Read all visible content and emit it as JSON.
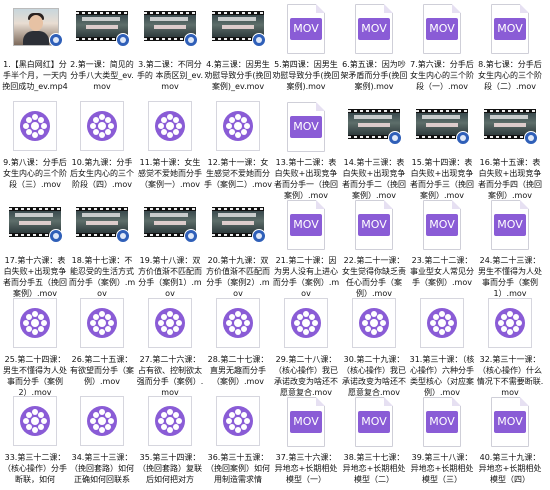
{
  "files": [
    {
      "name": "1.【黑白网红】分手半个月，一天内挽回成功_ev.mp4",
      "icon": "photo-thumbnail"
    },
    {
      "name": "2.第一课：简见的分手八大类型_ev.mov",
      "icon": "video-thumbnail"
    },
    {
      "name": "3.第二课：不同分手的 本质区别_ev.mov",
      "icon": "video-thumbnail"
    },
    {
      "name": "4.第三课：因男生劝慰导致分手(挽回案例)_ev.mov",
      "icon": "video-thumbnail"
    },
    {
      "name": "5.第四课：因男生劝慰导致分手(挽回案例).mov",
      "icon": "mov-icon"
    },
    {
      "name": "6.第五课：因为吵架矛盾而分手(挽回案例).mov",
      "icon": "mov-icon"
    },
    {
      "name": "7.第六课：分手后女生内心的三个阶段（一）.mov",
      "icon": "mov-icon"
    },
    {
      "name": "8.第七课：分手后女生内心的三个阶段（二）.mov",
      "icon": "mov-icon"
    },
    {
      "name": "9.第八课：分手后女生内心的三个阶段（三）.mov",
      "icon": "reel-icon"
    },
    {
      "name": "10.第九课：分手后女生内心的三个阶段（四）.mov",
      "icon": "reel-icon"
    },
    {
      "name": "11.第十课：女生感觉不爱她而分手（案例一）.mov",
      "icon": "reel-icon"
    },
    {
      "name": "12.第十一课：女生感觉不爱她而分手（案例二）.mov",
      "icon": "reel-icon"
    },
    {
      "name": "13.第十二课：表白失败+出现竞争者而分手一（挽回案例）.mov",
      "icon": "mov-icon"
    },
    {
      "name": "14.第十三课：表白失败+出现竞争者而分手二（挽回案例）.mov",
      "icon": "video-thumbnail"
    },
    {
      "name": "15.第十四课：表白失败+出现竞争者而分手三（挽回案例）.mov",
      "icon": "video-thumbnail"
    },
    {
      "name": "16.第十五课：表白失败+出现竞争者而分手四（挽回案例）.mov",
      "icon": "video-thumbnail"
    },
    {
      "name": "17.第十六课：表白失败+出现竞争者而分手五（挽回案例）.mov",
      "icon": "video-thumbnail"
    },
    {
      "name": "18.第十七课：不能忍受的生活方式而分手（案例）.mov",
      "icon": "video-thumbnail"
    },
    {
      "name": "19.第十八课：双方价值渐不匹配而分手（案例1）.mov",
      "icon": "video-thumbnail"
    },
    {
      "name": "20.第十九课：双方价值渐不匹配而分手（案例2）.mov",
      "icon": "video-thumbnail"
    },
    {
      "name": "21.第二十课：因为男人没有上进心而分手（案例）.mov",
      "icon": "mov-icon"
    },
    {
      "name": "22.第二十一课：女生觉得你缺乏责任心而分手（案例）.mov",
      "icon": "mov-icon"
    },
    {
      "name": "23.第二十二课：事业型女人常见分手（案例）.mov",
      "icon": "mov-icon"
    },
    {
      "name": "24.第二十三课：男生不懂得为人处事而分手（案例1）.mov",
      "icon": "mov-icon"
    },
    {
      "name": "25.第二十四课：男生不懂得为人处事而分手（案例2）.mov",
      "icon": "reel-icon"
    },
    {
      "name": "26.第二十五课：有欲望而分手（案例）.mov",
      "icon": "reel-icon"
    },
    {
      "name": "27.第二十六课：占有欲、控制欲太强而分手（案例）.mov",
      "icon": "reel-icon"
    },
    {
      "name": "28.第二十七课：直男无趣而分手（案例）.mov",
      "icon": "reel-icon"
    },
    {
      "name": "29.第二十八课：（核心操作）我已承诺改变为啥还不愿意复合.mov",
      "icon": "reel-icon"
    },
    {
      "name": "30.第二十九课：（核心操作）我已承诺改变为啥还不愿意复合.mov",
      "icon": "reel-icon"
    },
    {
      "name": "31.第三十课：（核心操作）六种分手类型核心（对应案例）.mov",
      "icon": "reel-icon"
    },
    {
      "name": "32.第三十一课：（核心操作）什么情况下不需要断联.mov",
      "icon": "reel-icon"
    },
    {
      "name": "33.第三十二课：（核心操作）分手断联，如何",
      "icon": "reel-icon"
    },
    {
      "name": "34.第三十三课：（挽回套路）如何正确如何回联系",
      "icon": "reel-icon"
    },
    {
      "name": "35.第三十四课：（挽回套路）复联后如何把对方",
      "icon": "reel-icon"
    },
    {
      "name": "36.第三十五课：（挽回案例）如何用制造需求情",
      "icon": "reel-icon"
    },
    {
      "name": "37.第三十六课：异地恋+长期相处模型（一）",
      "icon": "mov-icon"
    },
    {
      "name": "38.第三十七课：异地恋+长期相处模型（二）",
      "icon": "mov-icon"
    },
    {
      "name": "39.第三十八课：异地恋+长期相处模型（三）",
      "icon": "mov-icon"
    },
    {
      "name": "40.第三十九课：异地恋+长期相处模型（四）",
      "icon": "mov-icon"
    }
  ],
  "icon_text": {
    "mov": "MOV"
  },
  "colors": {
    "accent": "#8a5cd6"
  }
}
